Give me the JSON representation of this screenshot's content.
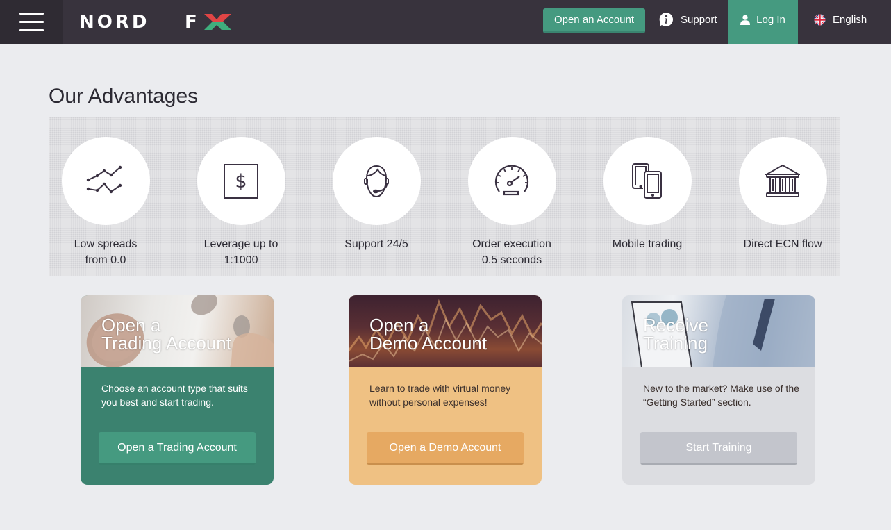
{
  "header": {
    "brand": "NORD FX",
    "brand_parts": [
      "NORD",
      "F",
      "X"
    ],
    "menu_icon": "hamburger-icon",
    "open_account_label": "Open an Account",
    "support_label": "Support",
    "support_icon": "info-bubble-icon",
    "login_label": "Log In",
    "login_icon": "user-icon",
    "language_label": "English",
    "language_icon": "uk-flag-icon"
  },
  "advantages": {
    "title": "Our Advantages",
    "items": [
      {
        "line1": "Low spreads",
        "line2": "from 0.0",
        "icon": "line-chart-icon"
      },
      {
        "line1": "Leverage up to",
        "line2": "1:1000",
        "icon": "dollar-icon"
      },
      {
        "line1": "Support 24/5",
        "line2": "",
        "icon": "headset-operator-icon"
      },
      {
        "line1": "Order execution",
        "line2": "0.5 seconds",
        "icon": "speedometer-icon"
      },
      {
        "line1": "Mobile trading",
        "line2": "",
        "icon": "mobile-devices-icon"
      },
      {
        "line1": "Direct ECN flow",
        "line2": "",
        "icon": "bank-icon"
      }
    ]
  },
  "cards": [
    {
      "title_line1": "Open a",
      "title_line2": "Trading Account",
      "description": "Choose an account type that suits you best and start trading.",
      "button": "Open a Trading Account"
    },
    {
      "title_line1": "Open a",
      "title_line2": "Demo Account",
      "description": "Learn to trade with virtual money without personal expenses!",
      "button": "Open a Demo Account"
    },
    {
      "title_line1": "Receive",
      "title_line2": "Training",
      "description": "New to the market? Make use of the “Getting Started” section.",
      "button": "Start Training"
    }
  ],
  "colors": {
    "header_bg": "#38333d",
    "accent_green": "#459a80",
    "logo_red": "#e04545",
    "logo_green": "#3fae7d",
    "icon_color": "#3a3142"
  }
}
